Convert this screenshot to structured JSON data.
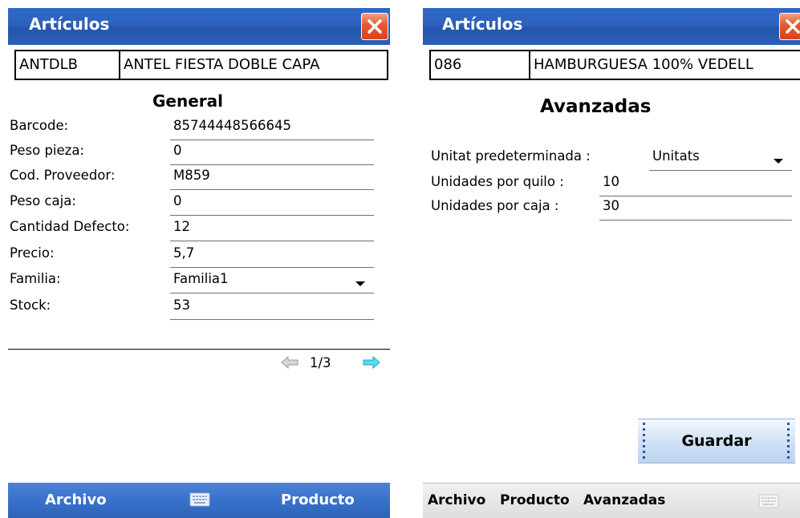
{
  "left": {
    "title": "Artículos",
    "code": "ANTDLB",
    "description": "ANTEL FIESTA DOBLE CAPA",
    "section": "General",
    "fields": [
      {
        "label": "Barcode:",
        "value": "85744448566645"
      },
      {
        "label": "Peso pieza:",
        "value": "0"
      },
      {
        "label": "Cod. Proveedor:",
        "value": "M859"
      },
      {
        "label": "Peso caja:",
        "value": "0"
      },
      {
        "label": "Cantidad Defecto:",
        "value": "12"
      },
      {
        "label": "Precio:",
        "value": "5,7"
      },
      {
        "label": "Familia:",
        "value": "Familia1"
      },
      {
        "label": "Stock:",
        "value": "53"
      }
    ],
    "page_indicator": "1/3",
    "menu": {
      "left": "Archivo",
      "right": "Producto"
    }
  },
  "right": {
    "title": "Artículos",
    "code": "086",
    "description": "HAMBURGUESA 100% VEDELL",
    "section": "Avanzadas",
    "unit_label": "Unitat predeterminada :",
    "unit_value": "Unitats",
    "per_kilo_label": "Unidades por quilo :",
    "per_kilo_value": "10",
    "per_box_label": "Unidades por caja :",
    "per_box_value": "30",
    "save_button": "Guardar",
    "menu": {
      "items": [
        "Archivo",
        "Producto",
        "Avanzadas"
      ]
    }
  },
  "colors": {
    "titlebar": "#2d62bd",
    "close_button": "#e6592c",
    "menubar_blue": "#3a73cc",
    "arrow_next": "#33c3e0",
    "arrow_prev": "#a6a6a6"
  }
}
